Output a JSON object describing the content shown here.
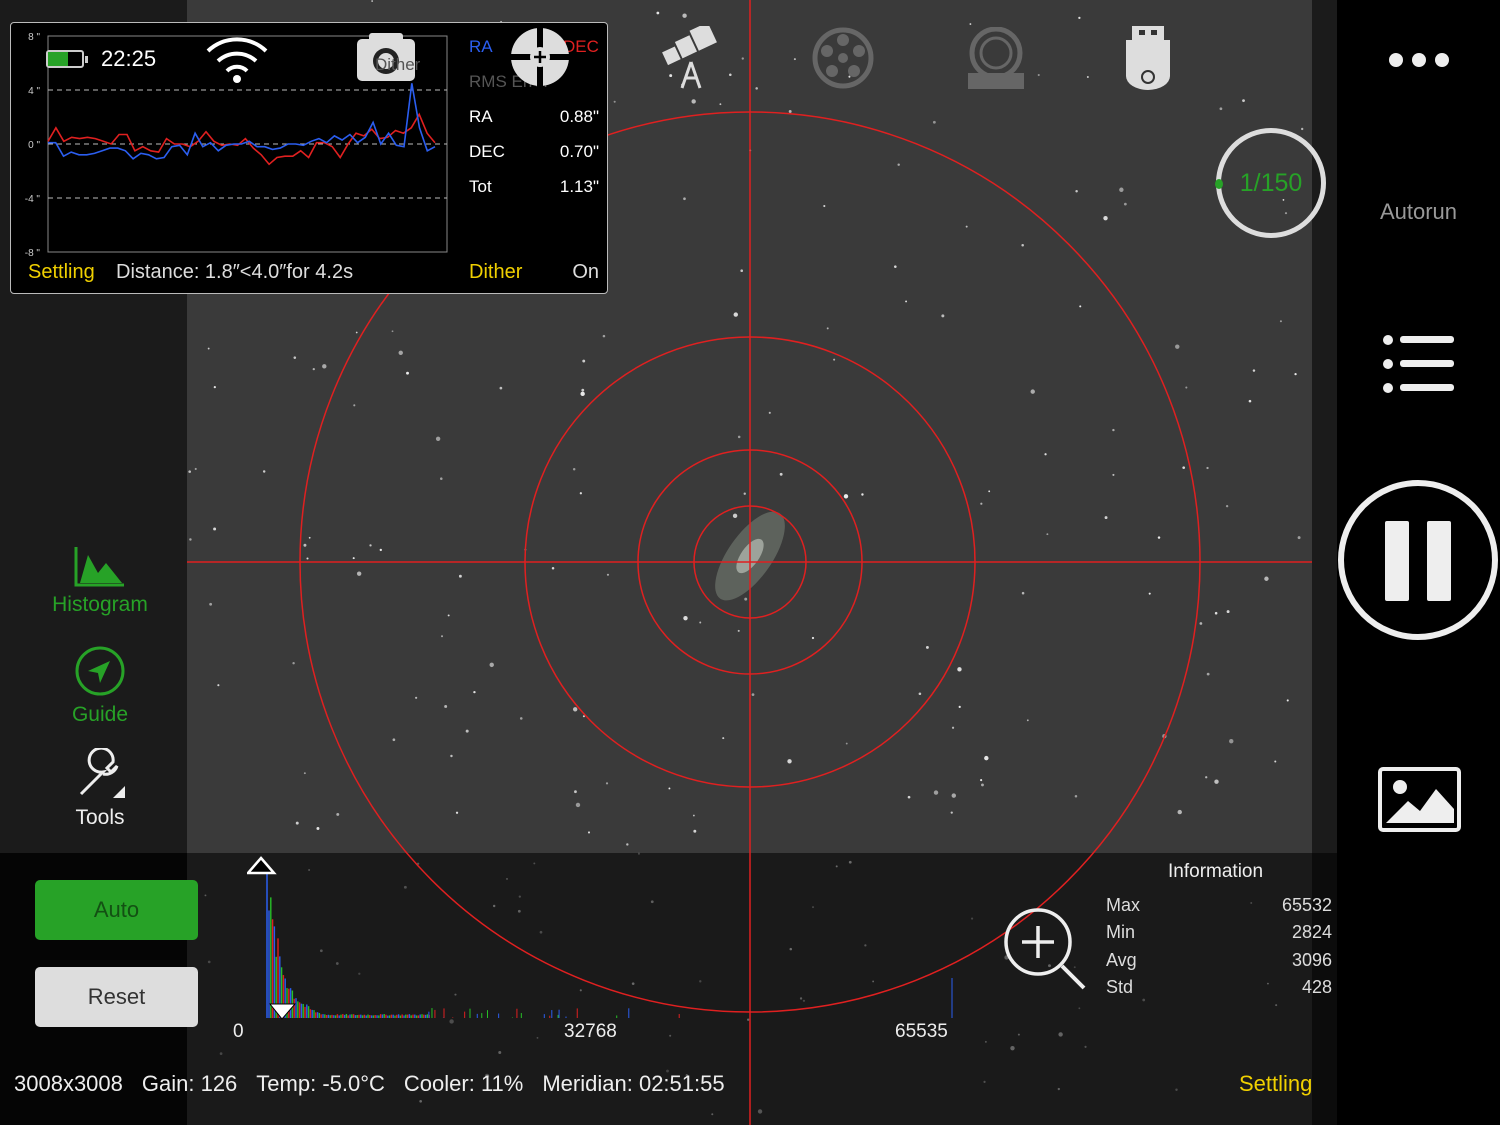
{
  "status": {
    "time": "22:25",
    "battery_level": 0.6
  },
  "guide_panel": {
    "legend_ra": "RA",
    "legend_dec": "DEC",
    "rms_label": "RMS Error",
    "dither_overlay": "Dither",
    "rows": [
      {
        "label": "RA",
        "value": "0.88\""
      },
      {
        "label": "DEC",
        "value": "0.70\""
      },
      {
        "label": "Tot",
        "value": "1.13\""
      }
    ],
    "state": "Settling",
    "distance": "Distance: 1.8″<4.0″for 4.2s",
    "dither_label": "Dither",
    "dither_value": "On"
  },
  "chart_data": {
    "type": "line",
    "yticks": [
      "8 \"",
      "4 \"",
      "0 \"",
      "-4 \"",
      "-8 \""
    ],
    "ylim": [
      -8,
      8
    ],
    "series": [
      {
        "name": "RA",
        "color": "#2b5ef0",
        "values": [
          0.1,
          0.1,
          -0.9,
          -0.6,
          -0.8,
          -0.8,
          -0.7,
          -0.5,
          -0.3,
          -0.3,
          -0.5,
          -1.1,
          -0.7,
          -0.8,
          -1.1,
          -1.0,
          -0.2,
          -0.1,
          -0.8,
          0.8,
          -0.2,
          0.1,
          -0.5,
          -0.1,
          0,
          0,
          0.2,
          -0.2,
          -0.2,
          -0.4,
          -0.3,
          0,
          0,
          -0.1,
          0.2,
          0.4,
          0.1,
          0.6,
          0.3,
          0.7,
          0.1,
          0.5,
          1.6,
          0,
          0.8,
          -0.1,
          -0.2,
          4.5,
          1.2,
          -0.5,
          -0.2
        ]
      },
      {
        "name": "DEC",
        "color": "#e02020",
        "values": [
          0.2,
          1.2,
          0.2,
          0.5,
          0.4,
          0.5,
          0.4,
          0.2,
          0,
          0.7,
          0.7,
          -0.5,
          -0.2,
          -0.5,
          -0.6,
          0.4,
          0,
          0,
          -0.2,
          0.2,
          0.9,
          0.2,
          -0.1,
          0,
          -0.1,
          0.4,
          -0.3,
          -0.8,
          -1.5,
          -1,
          -0.9,
          -0.9,
          -0.5,
          -1,
          0.1,
          0.1,
          -0.2,
          -1,
          0,
          0.8,
          0.6,
          1.1,
          0.4,
          0.5,
          1,
          0.8,
          1.2,
          2.2,
          0.8,
          0.1
        ]
      }
    ]
  },
  "toolbar": {
    "icons": [
      "telescope-icon",
      "filter-wheel-icon",
      "focuser-icon",
      "usb-storage-icon"
    ]
  },
  "left_nav": [
    {
      "label": "Histogram"
    },
    {
      "label": "Guide"
    },
    {
      "label": "Tools"
    }
  ],
  "right_nav": {
    "more": "more-icon",
    "autorun": "Autorun",
    "sequence_progress": "1/150"
  },
  "histogram": {
    "auto": "Auto",
    "reset": "Reset",
    "axis": [
      "0",
      "32768",
      "65535"
    ]
  },
  "information": {
    "title": "Information",
    "rows": [
      {
        "label": "Max",
        "value": "65532"
      },
      {
        "label": "Min",
        "value": "2824"
      },
      {
        "label": "Avg",
        "value": "3096"
      },
      {
        "label": "Std",
        "value": "428"
      }
    ]
  },
  "footer": {
    "resolution": "3008x3008",
    "gain": "Gain: 126",
    "temp": "Temp: -5.0°C",
    "cooler": "Cooler: 11%",
    "meridian": "Meridian: 02:51:55",
    "state": "Settling"
  },
  "colors": {
    "accent": "#27a227",
    "warning": "#f0d000",
    "crosshair": "#e02020"
  }
}
